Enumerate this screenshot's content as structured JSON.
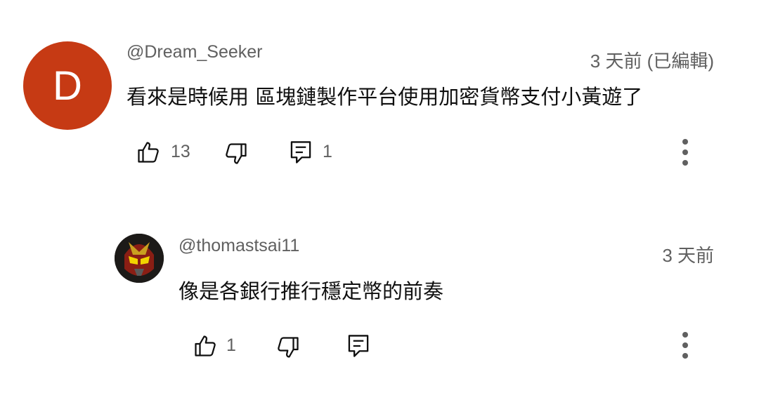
{
  "comments": [
    {
      "avatar_letter": "D",
      "avatar_color": "#c63a14",
      "username": "@Dream_Seeker",
      "timestamp": "3 天前 (已編輯)",
      "text": "看來是時候用 區塊鏈製作平台使用加密貨幣支付小黃遊了",
      "likes": "13",
      "replies": "1"
    },
    {
      "avatar": "masked-rider-avatar",
      "username": "@thomastsai11",
      "timestamp": "3 天前",
      "text": "像是各銀行推行穩定幣的前奏",
      "likes": "1"
    }
  ],
  "icons": {
    "like": "thumbs-up-icon",
    "dislike": "thumbs-down-icon",
    "reply": "reply-icon",
    "more": "more-vert-icon"
  }
}
